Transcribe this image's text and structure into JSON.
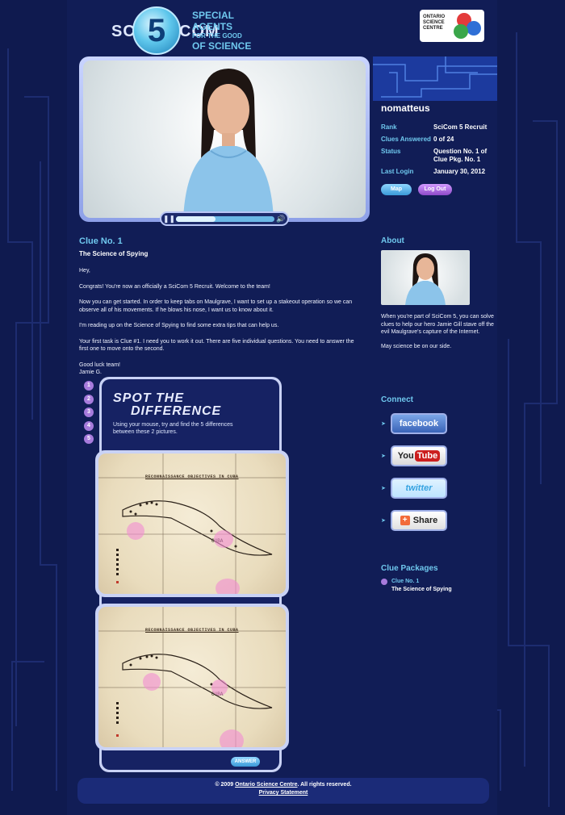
{
  "header": {
    "logo_sci": "SCI",
    "logo_five": "5",
    "logo_com": "COM",
    "tagline_1": "Special Agents",
    "tagline_2": "for the good",
    "tagline_3": "of Science",
    "osc_logo_line1": "ONTARIO",
    "osc_logo_line2": "SCIENCE",
    "osc_logo_line3": "CENTRE"
  },
  "video": {
    "play_icon": "pause-icon",
    "volume_icon": "volume-icon",
    "progress": 0.4
  },
  "user": {
    "username": "nomatteus",
    "rows": [
      {
        "label": "Rank",
        "value": "SciCom 5 Recruit"
      },
      {
        "label": "Clues Answered",
        "value": "0 of 24"
      },
      {
        "label": "Status",
        "value": "Question No. 1 of Clue Pkg. No. 1"
      },
      {
        "label": "Last Login",
        "value": "January 30, 2012"
      }
    ],
    "map_label": "Map",
    "logout_label": "Log Out"
  },
  "clue": {
    "heading": "Clue No. 1",
    "subheading": "The Science of Spying",
    "paragraphs": [
      "Hey,",
      "Congrats! You're now an officially a SciCom 5 Recruit. Welcome to the team!",
      "Now you can get started. In order to keep tabs on Maulgrave, I want to set up a stakeout operation so we can observe all of his movements. If he blows his nose, I want us to know about it.",
      "I'm reading up on the Science of Spying to find some extra tips that can help us.",
      "Your first task is Clue #1. I need you to work it out. There are five individual questions. You need to answer the first one to move onto the second.",
      "Good luck team!\nJamie G."
    ]
  },
  "game": {
    "steps": [
      "1",
      "2",
      "3",
      "4",
      "5"
    ],
    "title_line1": "SPOT THE",
    "title_line2": "DIFFERENCE",
    "description": "Using your mouse, try and find the 5 differences between these 2 pictures.",
    "map_title": "RECONNAISSANCE OBJECTIVES IN CUBA",
    "answer_label": "ANSWER"
  },
  "sidebar": {
    "about_heading": "About",
    "about_p1": "When you're part of SciCom 5, you can solve clues to help our hero Jamie Gill stave off the evil Maulgrave's capture of the Internet.",
    "about_p2": "May science be on our side.",
    "connect_heading": "Connect",
    "social": [
      {
        "name": "facebook",
        "label": "facebook"
      },
      {
        "name": "youtube",
        "label": "You",
        "label2": "Tube"
      },
      {
        "name": "twitter",
        "label": "twitter"
      },
      {
        "name": "share",
        "label": "Share"
      }
    ],
    "packages_heading": "Clue Packages",
    "package_title": "Clue No. 1",
    "package_sub": "The Science of Spying"
  },
  "footer": {
    "copyright_prefix": "© 2009",
    "copyright_link": "Ontario Science Centre",
    "copyright_suffix": ". All rights reserved.",
    "privacy": "Privacy Statement"
  },
  "colors": {
    "background": "#0f1a4f",
    "accent_cyan": "#6fc8ee",
    "accent_purple": "#a77bdc"
  }
}
